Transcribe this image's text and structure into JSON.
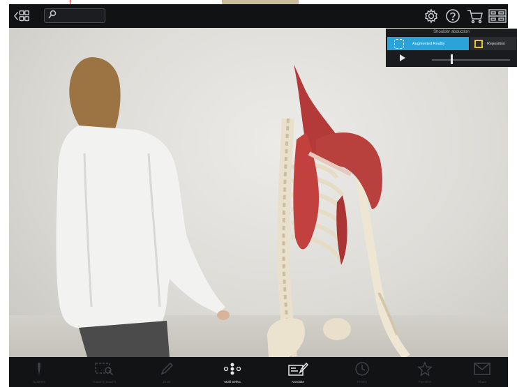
{
  "panel": {
    "title": "Shoulder abduction",
    "modes": [
      {
        "label": "Augmented Reality",
        "active": true
      },
      {
        "label": "Reposition",
        "active": false
      }
    ],
    "animation_progress": 0.25
  },
  "bottom_nav": [
    {
      "label": "Systems",
      "icon": "systems-icon"
    },
    {
      "label": "Anatomy Search",
      "icon": "anatomy-search-icon"
    },
    {
      "label": "Draw",
      "icon": "pencil-icon"
    },
    {
      "label": "Multi Select",
      "icon": "multi-select-icon"
    },
    {
      "label": "Annotate",
      "icon": "annotate-icon"
    },
    {
      "label": "History",
      "icon": "history-icon"
    },
    {
      "label": "Favorites",
      "icon": "star-icon"
    },
    {
      "label": "Share",
      "icon": "envelope-icon"
    }
  ],
  "colors": {
    "accent": "#29a3d9",
    "active_label": "#e8e9eb",
    "inactive_label": "#3f4246"
  }
}
